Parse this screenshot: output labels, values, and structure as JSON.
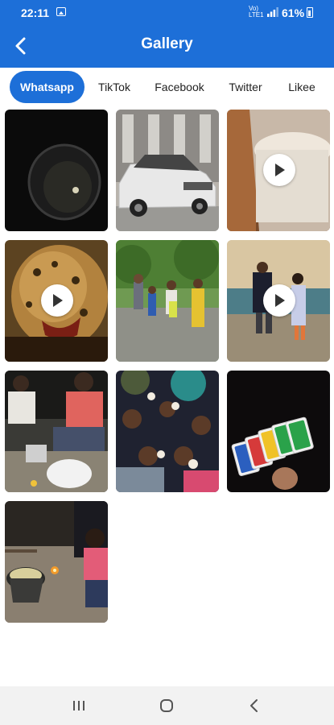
{
  "status_bar": {
    "time": "22:11",
    "net_label_top": "Vo)",
    "net_label_bottom": "LTE1",
    "battery": "61%",
    "icons": [
      "image-notification-icon",
      "signal-icon",
      "battery-icon"
    ]
  },
  "header": {
    "title": "Gallery",
    "back_icon": "arrow-left-icon"
  },
  "tabs": [
    {
      "label": "Whatsapp",
      "active": true
    },
    {
      "label": "TikTok",
      "active": false
    },
    {
      "label": "Facebook",
      "active": false
    },
    {
      "label": "Twitter",
      "active": false
    },
    {
      "label": "Likee",
      "active": false
    }
  ],
  "gallery": [
    {
      "type": "image",
      "subject": "dark pot photo"
    },
    {
      "type": "image",
      "subject": "white suv photo"
    },
    {
      "type": "video",
      "subject": "milk glass video"
    },
    {
      "type": "video",
      "subject": "leopard video"
    },
    {
      "type": "image",
      "subject": "family in rain photo"
    },
    {
      "type": "video",
      "subject": "couple on beach video"
    },
    {
      "type": "image",
      "subject": "friends cooking photo"
    },
    {
      "type": "image",
      "subject": "group circle photo"
    },
    {
      "type": "image",
      "subject": "uno cards photo"
    },
    {
      "type": "image",
      "subject": "campfire cooking photo"
    }
  ],
  "colors": {
    "accent": "#1d6fd8"
  },
  "nav_bar": {
    "icons": [
      "recents-icon",
      "home-icon",
      "back-icon"
    ]
  }
}
